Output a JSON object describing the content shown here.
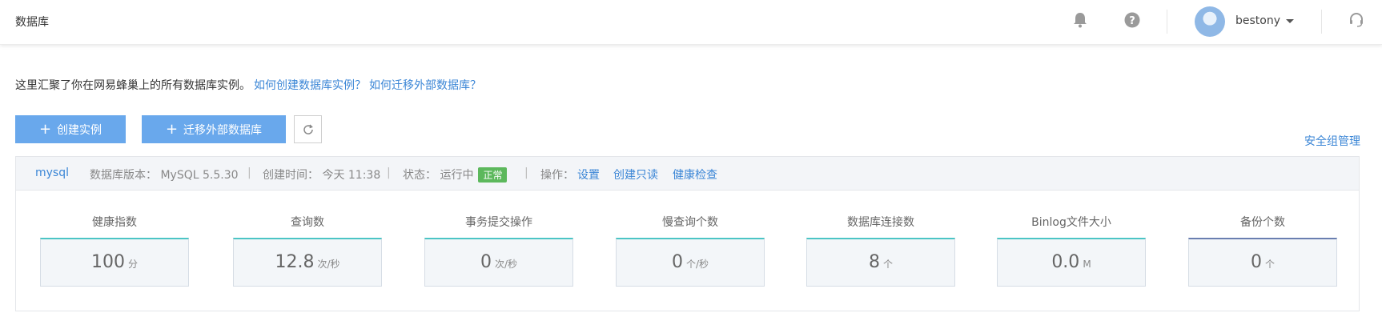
{
  "header": {
    "title": "数据库",
    "username": "bestony"
  },
  "intro": {
    "text": "这里汇聚了你在网易蜂巢上的所有数据库实例。",
    "link_create": "如何创建数据库实例？",
    "link_migrate": "如何迁移外部数据库？"
  },
  "toolbar": {
    "create_label": "创建实例",
    "migrate_label": "迁移外部数据库",
    "security_group_label": "安全组管理"
  },
  "instance": {
    "name": "mysql",
    "version_label": "数据库版本：",
    "version_value": "MySQL 5.5.30",
    "created_label": "创建时间：",
    "created_value": "今天 11:38",
    "status_label": "状态：",
    "status_value": "运行中",
    "status_badge": "正常",
    "ops_label": "操作：",
    "op_settings": "设置",
    "op_readonly": "创建只读",
    "op_health": "健康检查"
  },
  "metrics": [
    {
      "label": "健康指数",
      "value": "100",
      "unit": "分"
    },
    {
      "label": "查询数",
      "value": "12.8",
      "unit": "次/秒"
    },
    {
      "label": "事务提交操作",
      "value": "0",
      "unit": "次/秒"
    },
    {
      "label": "慢查询个数",
      "value": "0",
      "unit": "个/秒"
    },
    {
      "label": "数据库连接数",
      "value": "8",
      "unit": "个"
    },
    {
      "label": "Binlog文件大小",
      "value": "0.0",
      "unit": "M"
    },
    {
      "label": "备份个数",
      "value": "0",
      "unit": "个"
    }
  ],
  "colors": {
    "accent": "#3b86d6",
    "button": "#69a8ec",
    "badge": "#5cb85c",
    "metric_top": "#4cc5c5"
  }
}
